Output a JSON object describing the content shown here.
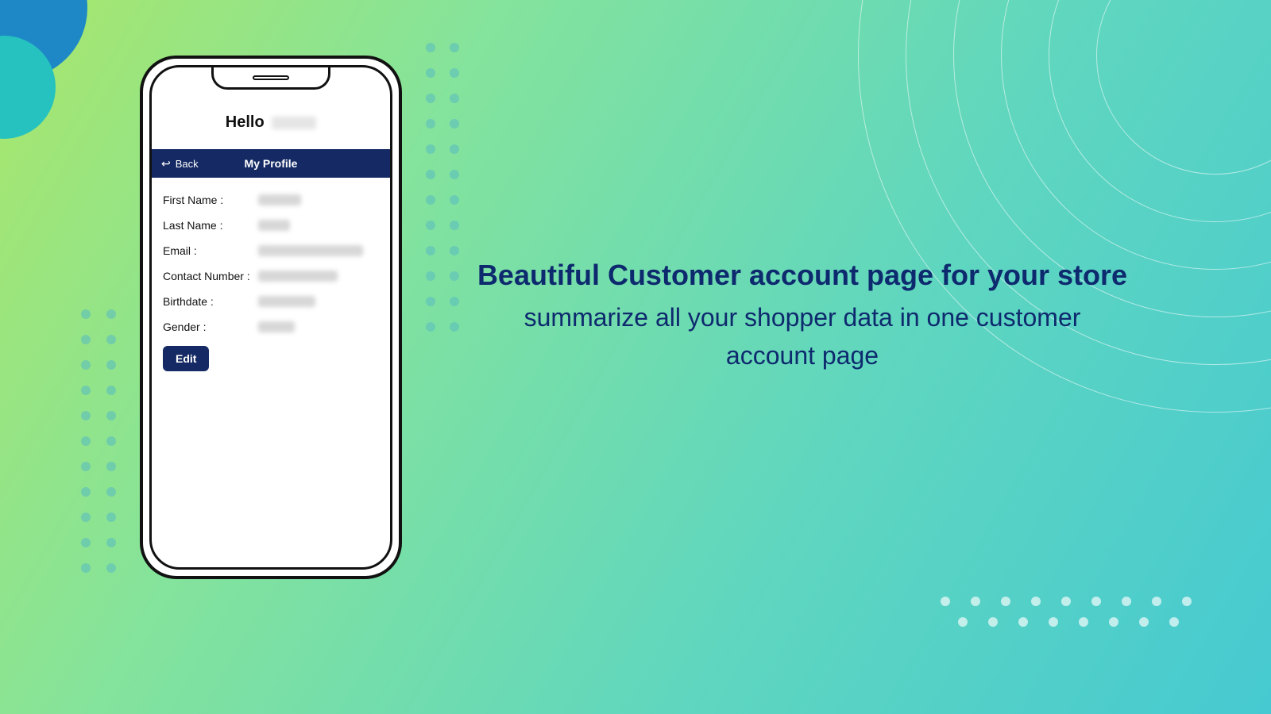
{
  "phone": {
    "greeting_prefix": "Hello",
    "navbar": {
      "back_label": "Back",
      "title": "My Profile"
    },
    "fields": {
      "first_name": "First Name :",
      "last_name": "Last Name :",
      "email": "Email :",
      "contact": "Contact Number :",
      "birthdate": "Birthdate :",
      "gender": "Gender :"
    },
    "edit_label": "Edit"
  },
  "marketing": {
    "headline": "Beautiful Customer account page for your store",
    "sub": "summarize all your shopper data in one customer account page"
  }
}
